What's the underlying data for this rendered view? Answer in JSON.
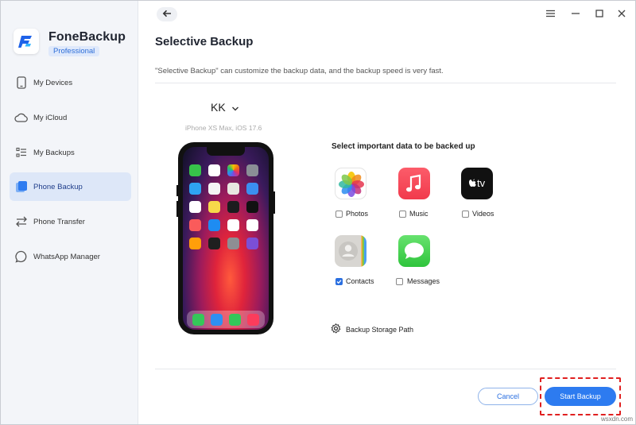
{
  "app": {
    "name": "FoneBackup",
    "edition": "Professional"
  },
  "sidebar": {
    "items": [
      {
        "label": "My Devices",
        "icon": "phone-outline-icon"
      },
      {
        "label": "My iCloud",
        "icon": "cloud-icon"
      },
      {
        "label": "My Backups",
        "icon": "list-icon"
      },
      {
        "label": "Phone Backup",
        "icon": "phone-backup-icon",
        "active": true
      },
      {
        "label": "Phone Transfer",
        "icon": "swap-arrows-icon"
      },
      {
        "label": "WhatsApp Manager",
        "icon": "chat-bubble-icon"
      }
    ]
  },
  "window_controls": [
    "menu-icon",
    "minimize-icon",
    "maximize-icon",
    "close-icon"
  ],
  "main": {
    "title": "Selective Backup",
    "description": "\"Selective Backup\" can customize the backup data, and the backup speed is very fast.",
    "device": {
      "name": "KK",
      "model": "iPhone XS Max, iOS 17.6"
    },
    "select_title": "Select important data to be backed up",
    "data_items": [
      {
        "label": "Photos",
        "checked": false,
        "icon": "photos-icon"
      },
      {
        "label": "Music",
        "checked": false,
        "icon": "music-icon"
      },
      {
        "label": "Videos",
        "checked": false,
        "icon": "apple-tv-icon",
        "icon_text": "tv"
      },
      {
        "label": "Contacts",
        "checked": true,
        "icon": "contacts-icon"
      },
      {
        "label": "Messages",
        "checked": false,
        "icon": "messages-icon"
      }
    ],
    "storage_path_label": "Backup Storage Path",
    "cancel_label": "Cancel",
    "start_label": "Start Backup"
  },
  "colors": {
    "accent": "#2d7bf0",
    "active_nav": "#dde7f8",
    "highlight": "#e02020"
  },
  "watermark": "wsxdn.com"
}
